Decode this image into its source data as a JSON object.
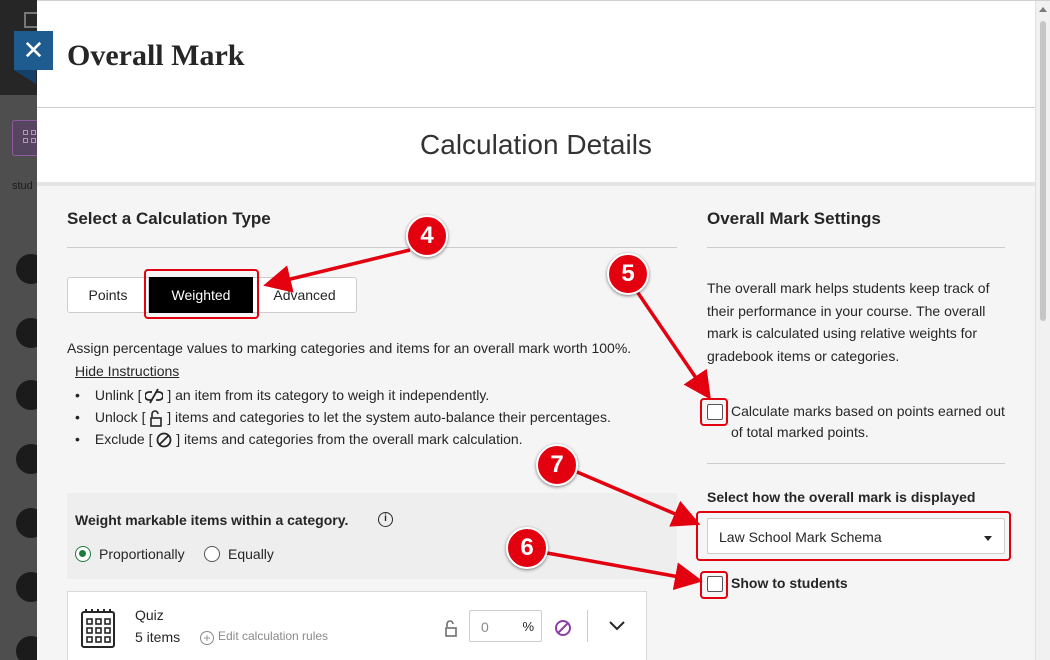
{
  "panel": {
    "title": "Overall Mark",
    "close_label": "✕",
    "section_title": "Calculation Details"
  },
  "background_app": {
    "truncated_label": "stud"
  },
  "calculation": {
    "heading": "Select a Calculation Type",
    "types": [
      {
        "label": "Points",
        "selected": false
      },
      {
        "label": "Weighted",
        "selected": true
      },
      {
        "label": "Advanced",
        "selected": false
      }
    ],
    "instruction": "Assign percentage values to marking categories and items for an overall mark worth 100%.",
    "hide_instructions": "Hide Instructions",
    "bullets": [
      {
        "before": "Unlink [",
        "icon": "unlink-icon",
        "after": "] an item from its category to weigh it independently."
      },
      {
        "before": "Unlock [",
        "icon": "unlock-icon",
        "after": "] items and categories to let the system auto-balance their percentages."
      },
      {
        "before": "Exclude [",
        "icon": "exclude-icon",
        "after": "] items and categories from the overall mark calculation."
      }
    ]
  },
  "weighting": {
    "label": "Weight markable items within a category.",
    "info_icon": "i",
    "options": [
      {
        "label": "Proportionally",
        "selected": true
      },
      {
        "label": "Equally",
        "selected": false
      }
    ]
  },
  "category_card": {
    "name": "Quiz",
    "count": "5 items",
    "edit_rules": "Edit calculation rules",
    "percent_value": "0",
    "percent_unit": "%"
  },
  "settings": {
    "heading": "Overall Mark Settings",
    "description": "The overall mark helps students keep track of their performance in your course. The overall mark is calculated using relative weights for gradebook items or categories.",
    "points_checkbox_label": "Calculate marks based on points earned out of total marked points.",
    "points_checked": false,
    "display_label": "Select how the overall mark is displayed",
    "schema_selected": "Law School Mark Schema",
    "show_students_label": "Show to students",
    "show_checked": false
  },
  "annotations": {
    "badges": [
      "4",
      "5",
      "7",
      "6"
    ],
    "color": "#e3000f"
  },
  "colors": {
    "selected_segment": "#000000",
    "radio_accent": "#1e7c3e",
    "close_tab": "#1e5b8e",
    "exclude_icon": "#8e3fa6"
  }
}
